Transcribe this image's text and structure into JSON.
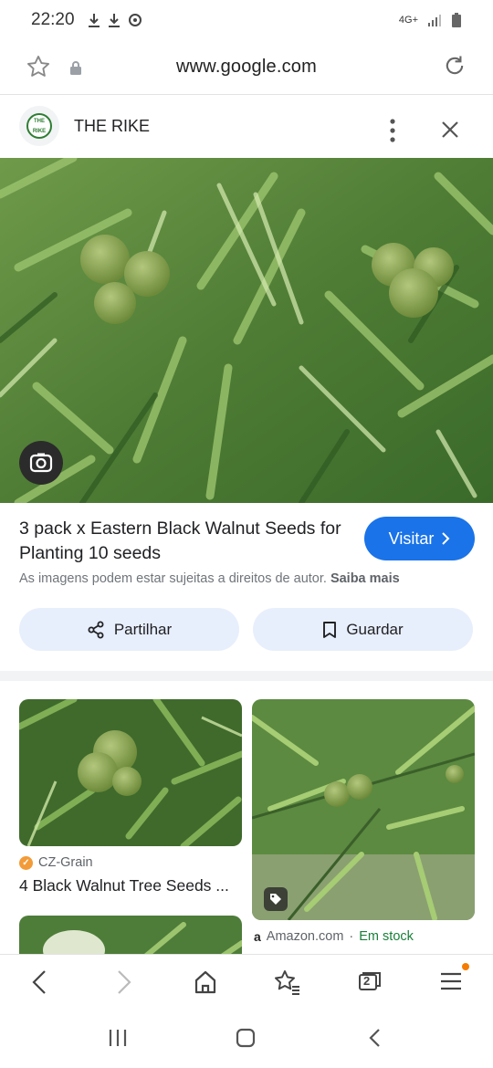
{
  "status_bar": {
    "time": "22:20",
    "network": "4G+"
  },
  "url_bar": {
    "url": "www.google.com"
  },
  "source": {
    "name": "THE RIKE",
    "logo_text": "THE RIKE"
  },
  "result": {
    "title": "3 pack x Eastern Black Walnut Seeds for Planting 10 seeds",
    "visit_label": "Visitar",
    "copyright_text": "As imagens podem estar sujeitas a direitos de autor.",
    "learn_more": "Saiba mais",
    "share_label": "Partilhar",
    "save_label": "Guardar"
  },
  "related": [
    {
      "source": "CZ-Grain",
      "title": "4 Black Walnut Tree Seeds ..."
    },
    {
      "source": "Amazon.com",
      "separator": " · ",
      "availability": "Em stock"
    }
  ],
  "icons": {
    "status": [
      "download-icon",
      "download-icon",
      "sync-icon",
      "signal-icon",
      "battery-icon"
    ],
    "url_bar": [
      "star-icon",
      "lock-icon",
      "reload-icon"
    ],
    "source": [
      "more-vert-icon",
      "close-icon"
    ],
    "browser_nav": [
      "back-icon",
      "forward-icon",
      "home-icon",
      "bookmarks-icon",
      "tabs-icon",
      "menu-icon"
    ],
    "system_nav": [
      "recents-icon",
      "home-button-icon",
      "system-back-icon"
    ]
  },
  "tabs_count": "2",
  "colors": {
    "accent": "#1a73e8",
    "pill_bg": "#e8effc",
    "stock": "#188038",
    "badge": "#f57c00"
  }
}
